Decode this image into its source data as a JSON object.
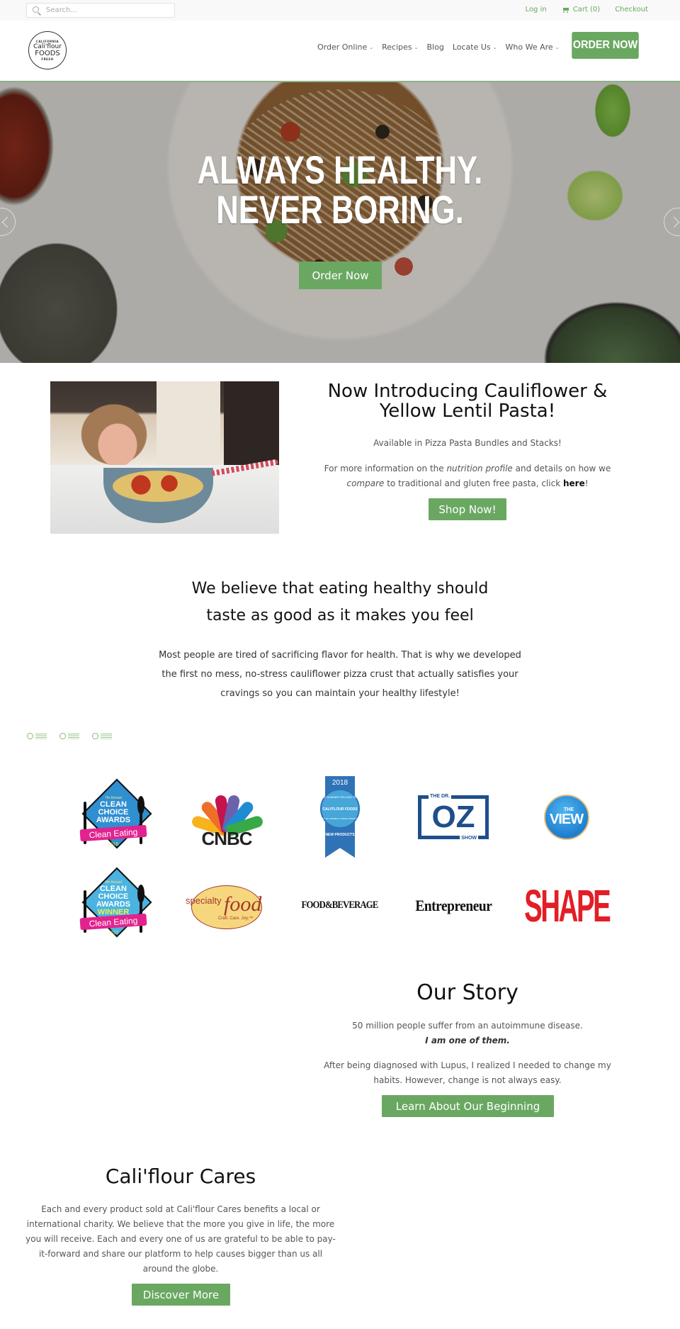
{
  "topbar": {
    "search_placeholder": "Search...",
    "login": "Log in",
    "cart": "Cart (0)",
    "checkout": "Checkout"
  },
  "header": {
    "logo": {
      "top": "CALIFORNIA",
      "line1": "Cali'flour",
      "line2": "FOODS",
      "bottom": "FRESH"
    },
    "nav": [
      {
        "label": "Order Online",
        "has_dropdown": true
      },
      {
        "label": "Recipes",
        "has_dropdown": true
      },
      {
        "label": "Blog",
        "has_dropdown": false
      },
      {
        "label": "Locate Us",
        "has_dropdown": true
      },
      {
        "label": "Who We Are",
        "has_dropdown": true
      }
    ],
    "chevron": "⌄",
    "order_now": "ORDER NOW"
  },
  "hero": {
    "line1": "ALWAYS HEALTHY.",
    "line2": "NEVER BORING.",
    "button": "Order Now"
  },
  "pasta": {
    "title": "Now Introducing Cauliflower & Yellow Lentil Pasta!",
    "available": "Available in Pizza Pasta Bundles and Stacks!",
    "info_1": "For more information on the ",
    "info_em1": "nutrition profile",
    "info_2": " and details on how we ",
    "info_em2": "compare",
    "info_3": " to traditional and gluten free pasta, click ",
    "info_link": "here",
    "info_4": "!",
    "button": "Shop Now!"
  },
  "believe": {
    "title_line1": "We believe that eating healthy should",
    "title_line2": "taste as good as it makes you feel",
    "body": "Most people are tired of sacrificing flavor for health. That is why we developed the first no mess, no-stress cauliflower pizza crust that actually satisfies your cravings so you can maintain your healthy lifestyle!"
  },
  "press": {
    "cca2018": {
      "annual": "7th Annual",
      "lines": [
        "CLEAN",
        "CHOICE",
        "AWARDS"
      ],
      "ribbon": "Clean Eating",
      "year": "2018"
    },
    "cnbc": "CNBC",
    "kehe": {
      "year": "2018",
      "show": "KEHE SUMMER SELLING SHOW",
      "brand": "CALI'FLOUR FOODS",
      "ring": "BEST OF FROZEN & FRESH PRODUCTS",
      "award": "NEW PRODUCTS"
    },
    "oz": {
      "top": "THE DR.",
      "big": "OZ",
      "bottom": "SHOW"
    },
    "view": {
      "the": "THE",
      "view": "VIEW"
    },
    "cca2017": {
      "annual": "6th Annual",
      "lines": [
        "CLEAN",
        "CHOICE",
        "AWARDS"
      ],
      "winner": "WINNER",
      "ribbon": "Clean Eating",
      "year": "2017"
    },
    "specialty": {
      "word1": "specialty",
      "word2": "food",
      "tagline": "Craft. Care. Joy.™"
    },
    "fnb": "FOOD&BEVERAGE",
    "entrepreneur": "Entrepreneur",
    "shape": "SHAPE"
  },
  "story": {
    "title": "Our Story",
    "line1": "50 million people suffer from an autoimmune disease.",
    "line2": "I am one of them.",
    "body": "After being diagnosed with Lupus, I realized I needed to change my habits. However, change is not always easy.",
    "button": "Learn About Our Beginning"
  },
  "cares": {
    "title": "Cali'flour Cares",
    "body": "Each and every product sold at Cali'flour Cares benefits a local or international charity. We believe that the more you give in life, the more you will receive. Each and every one of us are grateful to be able to pay-it-forward and share our platform to help causes bigger than us all around the globe.",
    "button": "Discover More"
  },
  "colors": {
    "accent_green": "#6aa862",
    "heading": "#111111",
    "body_text": "#555555"
  }
}
